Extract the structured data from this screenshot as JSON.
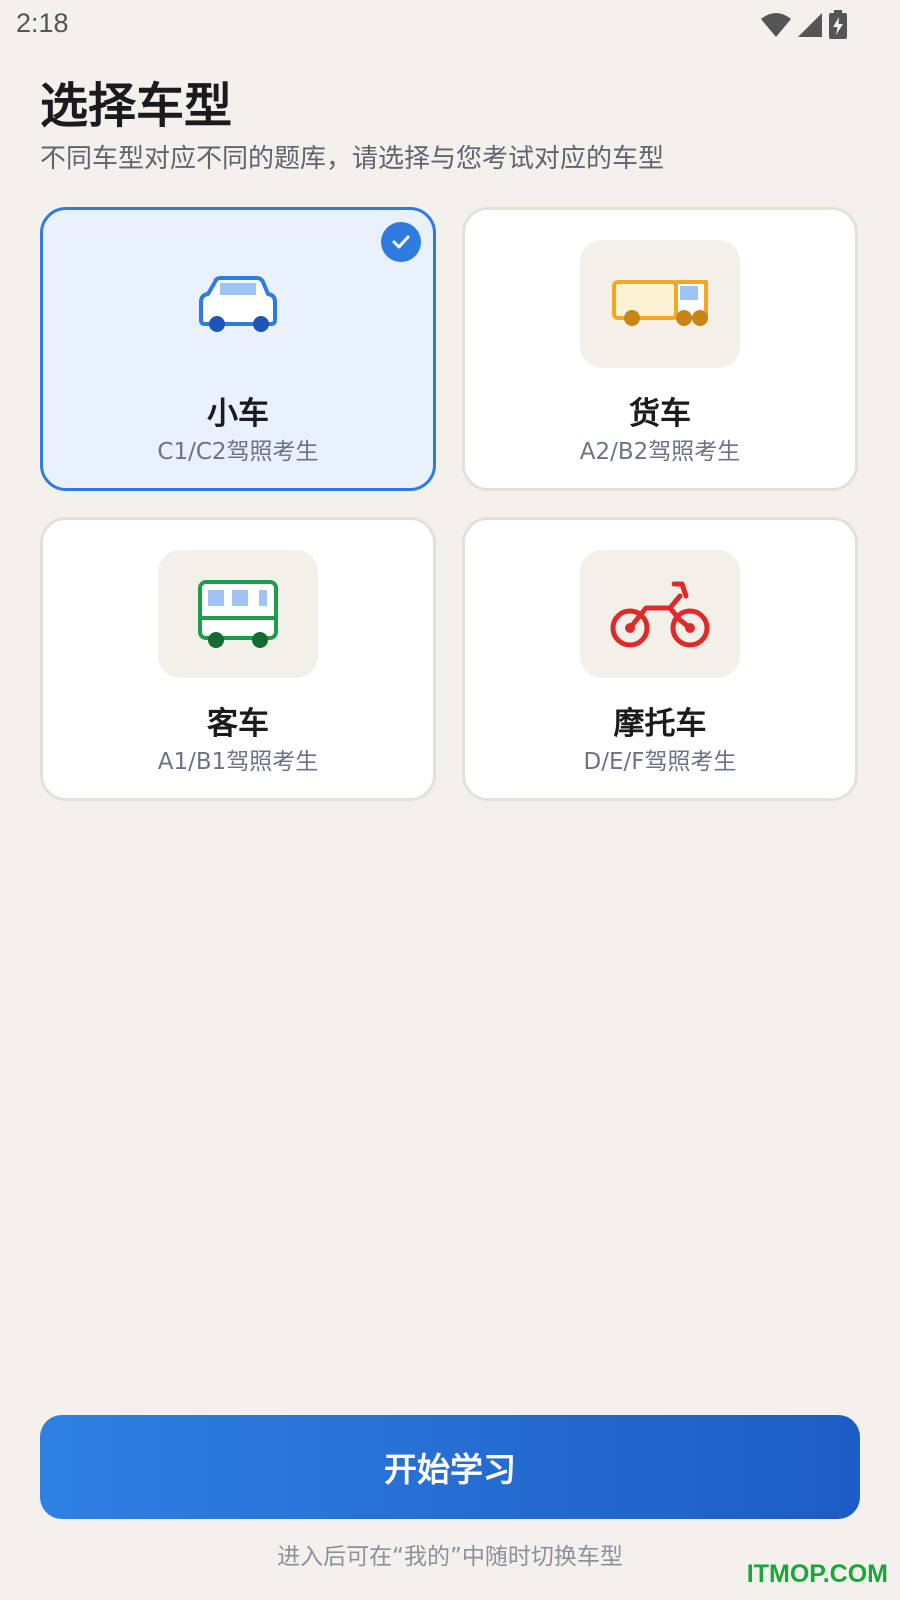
{
  "status_bar": {
    "time": "2:18",
    "icons": [
      "wifi-icon",
      "signal-icon",
      "battery-charging-icon"
    ]
  },
  "header": {
    "title": "选择车型",
    "subtitle": "不同车型对应不同的题库，请选择与您考试对应的车型"
  },
  "vehicle_types": [
    {
      "name": "小车",
      "desc": "C1/C2驾照考生",
      "icon": "car-icon",
      "color": "#2f7be0",
      "selected": true
    },
    {
      "name": "货车",
      "desc": "A2/B2驾照考生",
      "icon": "truck-icon",
      "color": "#f5a623",
      "selected": false
    },
    {
      "name": "客车",
      "desc": "A1/B1驾照考生",
      "icon": "bus-icon",
      "color": "#1e9c4b",
      "selected": false
    },
    {
      "name": "摩托车",
      "desc": "D/E/F驾照考生",
      "icon": "motorcycle-icon",
      "color": "#e02a2a",
      "selected": false
    }
  ],
  "selected_index": 0,
  "footer": {
    "start_button_label": "开始学习",
    "hint": "进入后可在“我的”中随时切换车型"
  },
  "watermark": "ITMOP.COM",
  "colors": {
    "accent": "#2f7be0",
    "background": "#f4f1ec",
    "selected_card_bg": "#e8f1fd"
  }
}
